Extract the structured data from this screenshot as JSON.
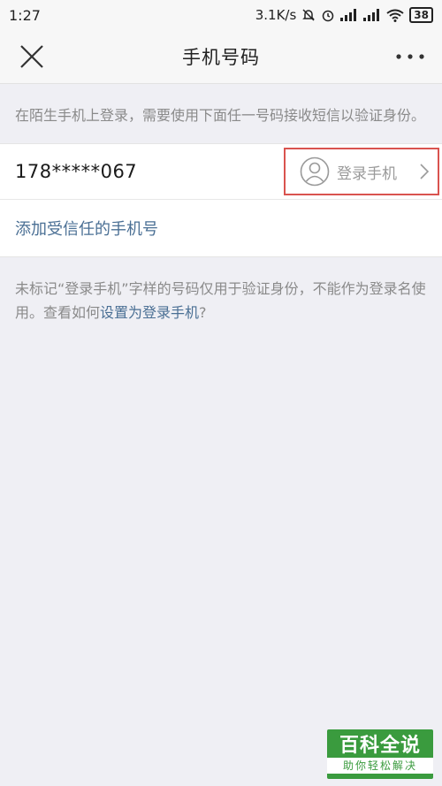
{
  "status_bar": {
    "time": "1:27",
    "net_speed": "3.1K/s",
    "battery": "38"
  },
  "nav": {
    "title": "手机号码"
  },
  "intro_text": "在陌生手机上登录，需要使用下面任一号码接收短信以验证身份。",
  "phones": [
    {
      "number": "178*****067",
      "login_label": "登录手机"
    }
  ],
  "add_trusted_label": "添加受信任的手机号",
  "note": {
    "text": "未标记“登录手机”字样的号码仅用于验证身份，不能作为登录名使用。查看如何",
    "link": "设置为登录手机",
    "suffix": "?"
  },
  "watermark": {
    "title": "百科全说",
    "subtitle": "助你轻松解决"
  }
}
